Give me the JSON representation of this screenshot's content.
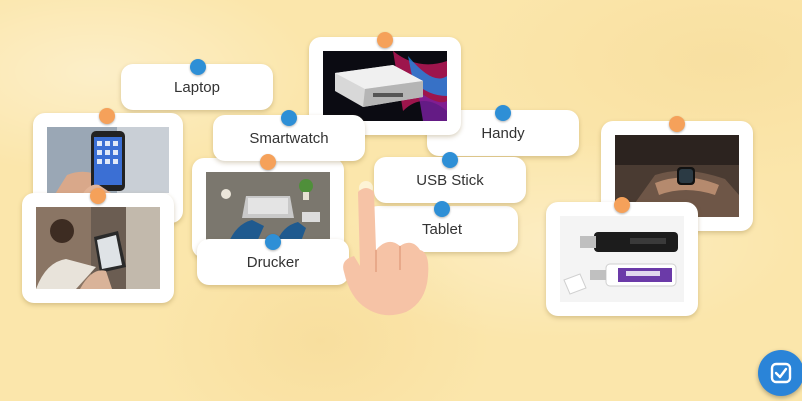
{
  "labels": {
    "laptop": "Laptop",
    "smartwatch": "Smartwatch",
    "handy": "Handy",
    "usb_stick": "USB Stick",
    "tablet": "Tablet",
    "drucker": "Drucker"
  },
  "images": {
    "printer": "printer-photo",
    "smartphone": "smartphone-photo",
    "tablet": "tablet-photo",
    "laptop": "laptop-photo",
    "smartwatch": "smartwatch-photo",
    "usb_stick": "usb-stick-photo"
  },
  "check_button": {
    "icon": "check-icon"
  },
  "colors": {
    "background": "#fbe6ab",
    "pin_blue": "#2e8fd6",
    "pin_orange": "#f5a15a",
    "check_button": "#2a84d8"
  }
}
